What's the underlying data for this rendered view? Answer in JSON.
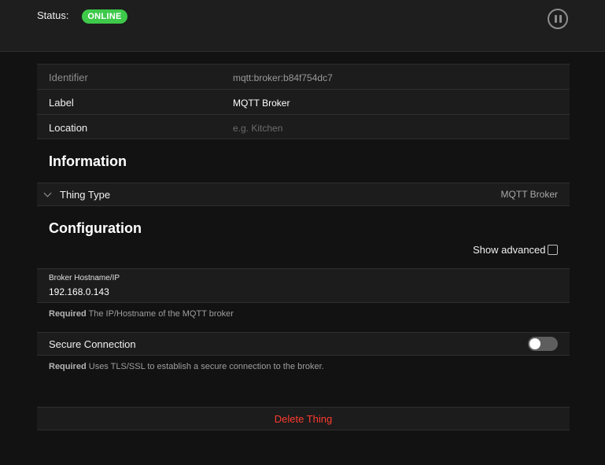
{
  "status": {
    "label": "Status:",
    "badge": "ONLINE"
  },
  "identity": {
    "identifier_label": "Identifier",
    "identifier_value": "mqtt:broker:b84f754dc7",
    "label_label": "Label",
    "label_value": "MQTT Broker",
    "location_label": "Location",
    "location_placeholder": "e.g. Kitchen"
  },
  "information": {
    "title": "Information",
    "thing_type_label": "Thing Type",
    "thing_type_value": "MQTT Broker"
  },
  "configuration": {
    "title": "Configuration",
    "show_advanced_label": "Show advanced",
    "broker_host_label": "Broker Hostname/IP",
    "broker_host_value": "192.168.0.143",
    "broker_host_hint_required": "Required",
    "broker_host_hint_text": " The IP/Hostname of the MQTT broker",
    "secure_label": "Secure Connection",
    "secure_hint_required": "Required",
    "secure_hint_text": " Uses TLS/SSL to establish a secure connection to the broker.",
    "secure_enabled": false
  },
  "actions": {
    "delete_label": "Delete Thing"
  },
  "colors": {
    "online": "#3ec94b",
    "danger": "#ff3b30",
    "background": "#121212"
  },
  "icons": {
    "pause": "pause-circle-icon",
    "chevron": "chevron-down-icon"
  }
}
